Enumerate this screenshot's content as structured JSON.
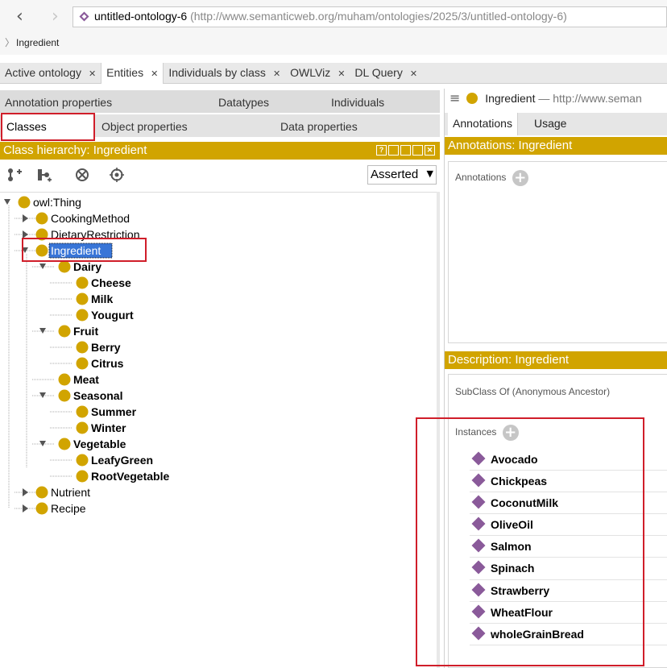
{
  "address_bar": {
    "ontology_name": "untitled-ontology-6",
    "ontology_iri": "(http://www.semanticweb.org/muham/ontologies/2025/3/untitled-ontology-6)",
    "breadcrumb": "Ingredient"
  },
  "workspace_tabs": [
    {
      "label": "Active ontology",
      "active": false
    },
    {
      "label": "Entities",
      "active": true
    },
    {
      "label": "Individuals by class",
      "active": false
    },
    {
      "label": "OWLViz",
      "active": false
    },
    {
      "label": "DL Query",
      "active": false
    }
  ],
  "entity_tabs": {
    "row1": [
      "Annotation properties",
      "Datatypes",
      "Individuals"
    ],
    "row2": [
      "Classes",
      "Object properties",
      "Data properties"
    ]
  },
  "class_hierarchy": {
    "title": "Class hierarchy: Ingredient",
    "dropdown_value": "Asserted",
    "tree": {
      "root": "owl:Thing",
      "top": [
        "CookingMethod",
        "DietaryRestriction",
        "Ingredient",
        "Nutrient",
        "Recipe"
      ],
      "selected": "Ingredient",
      "ingredient_children": [
        {
          "name": "Dairy",
          "children": [
            "Cheese",
            "Milk",
            "Yougurt"
          ]
        },
        {
          "name": "Fruit",
          "children": [
            "Berry",
            "Citrus"
          ]
        },
        {
          "name": "Meat",
          "children": []
        },
        {
          "name": "Seasonal",
          "children": [
            "Summer",
            "Winter"
          ]
        },
        {
          "name": "Vegetable",
          "children": [
            "LeafyGreen",
            "RootVegetable"
          ]
        }
      ]
    }
  },
  "right_panel": {
    "header_name": "Ingredient",
    "header_iri": "— http://www.seman",
    "tabs": [
      "Annotations",
      "Usage"
    ],
    "annotations_title": "Annotations: Ingredient",
    "annotations_label": "Annotations",
    "description_title": "Description: Ingredient",
    "subclass_label": "SubClass Of (Anonymous Ancestor)",
    "instances_label": "Instances",
    "instances": [
      "Avocado",
      "Chickpeas",
      "CoconutMilk",
      "OliveOil",
      "Salmon",
      "Spinach",
      "Strawberry",
      "WheatFlour",
      "wholeGrainBread"
    ]
  },
  "colors": {
    "class_dot": "#d1a400",
    "title_bar": "#d1a400",
    "individual_diamond": "#8a5a9a",
    "highlight_box": "#d01e2a",
    "selection": "#3875d7"
  },
  "icons": [
    "back-arrow-icon",
    "forward-arrow-icon",
    "ontology-icon",
    "add-subclass-icon",
    "add-sibling-icon",
    "delete-class-icon",
    "find-usages-icon",
    "hamburger-menu-icon",
    "add-annotation-icon",
    "add-instance-icon"
  ]
}
